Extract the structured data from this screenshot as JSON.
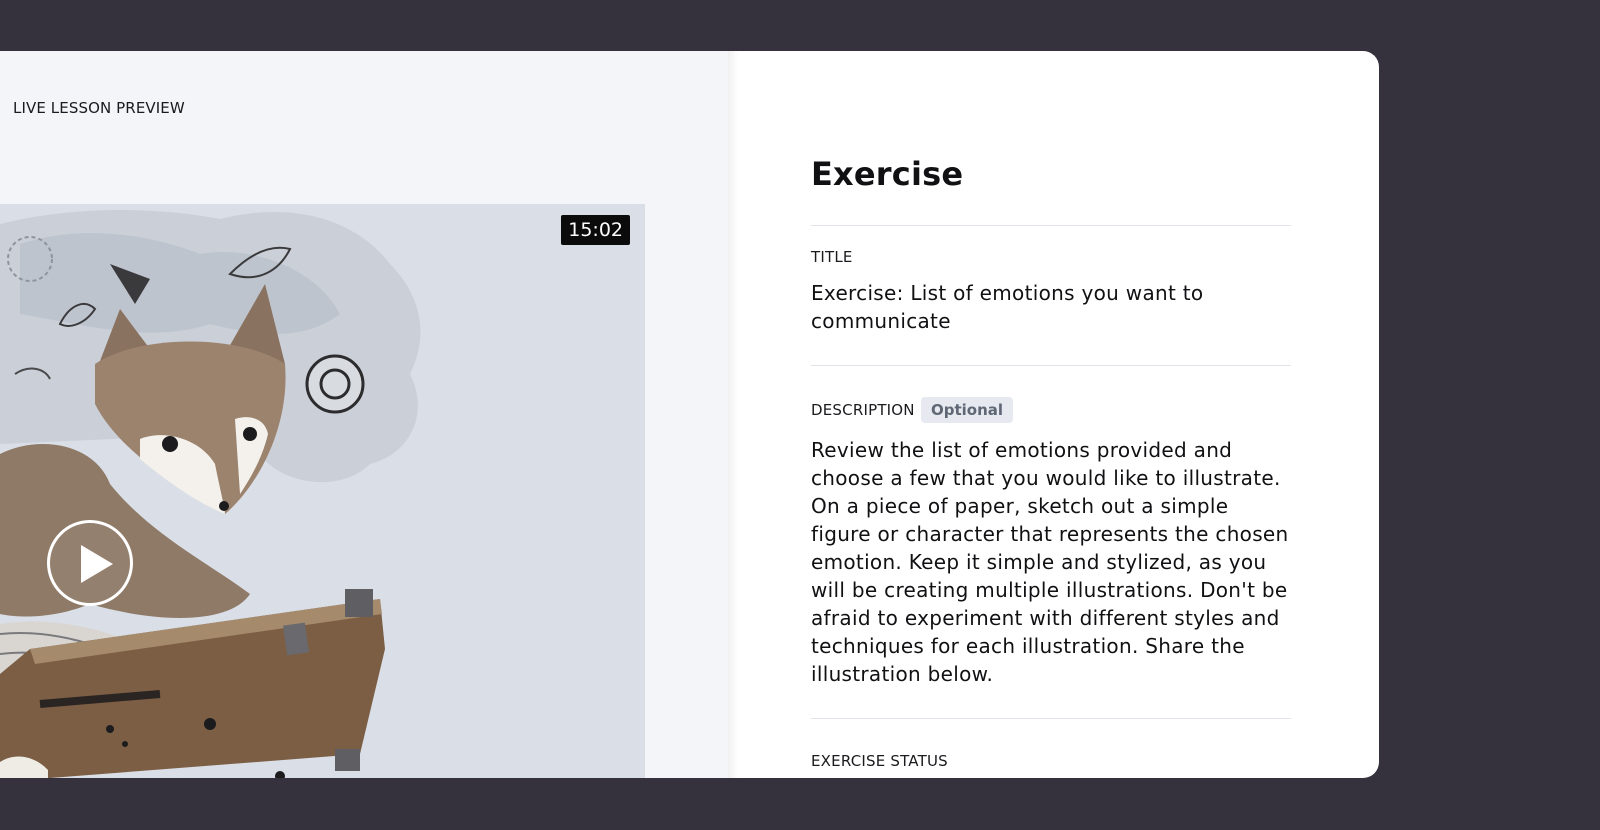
{
  "preview": {
    "label": "LIVE LESSON PREVIEW",
    "duration": "15:02"
  },
  "exercise": {
    "heading": "Exercise",
    "title_label": "TITLE",
    "title_value": "Exercise: List of emotions you want to communicate",
    "description_label": "DESCRIPTION",
    "optional_badge": "Optional",
    "description_value": "Review the list of emotions provided and choose a few that you would like to illustrate. On a piece of paper, sketch out a simple figure or character that represents the chosen emotion. Keep it simple and stylized, as you will be creating multiple illustrations. Don't be afraid to experiment with different styles and techniques for each illustration. Share the illustration below.",
    "status_label": "EXERCISE STATUS"
  },
  "icons": [
    "play-icon"
  ],
  "colors": {
    "backdrop": "#35313d",
    "panel": "#ffffff",
    "preview_pane": "#f3f5f9",
    "badge_bg": "#e6e9ef",
    "badge_text": "#5f6674"
  }
}
